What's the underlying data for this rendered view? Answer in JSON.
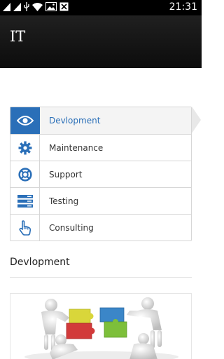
{
  "status_bar": {
    "time": "21:31",
    "icons": [
      "signal-icon",
      "signal-icon",
      "usb-icon",
      "wifi-icon",
      "image-icon",
      "close-box-icon"
    ]
  },
  "app_bar": {
    "title": "IT"
  },
  "menu": {
    "items": [
      {
        "label": "Devlopment",
        "icon": "eye-icon",
        "active": true
      },
      {
        "label": "Maintenance",
        "icon": "gear-icon",
        "active": false
      },
      {
        "label": "Support",
        "icon": "lifebuoy-icon",
        "active": false
      },
      {
        "label": "Testing",
        "icon": "server-icon",
        "active": false
      },
      {
        "label": "Consulting",
        "icon": "pointer-hand-icon",
        "active": false
      }
    ]
  },
  "content": {
    "section_title": "Devlopment"
  },
  "colors": {
    "accent": "#2a6fb8",
    "app_bar": "#141414",
    "status_bar": "#000000"
  }
}
